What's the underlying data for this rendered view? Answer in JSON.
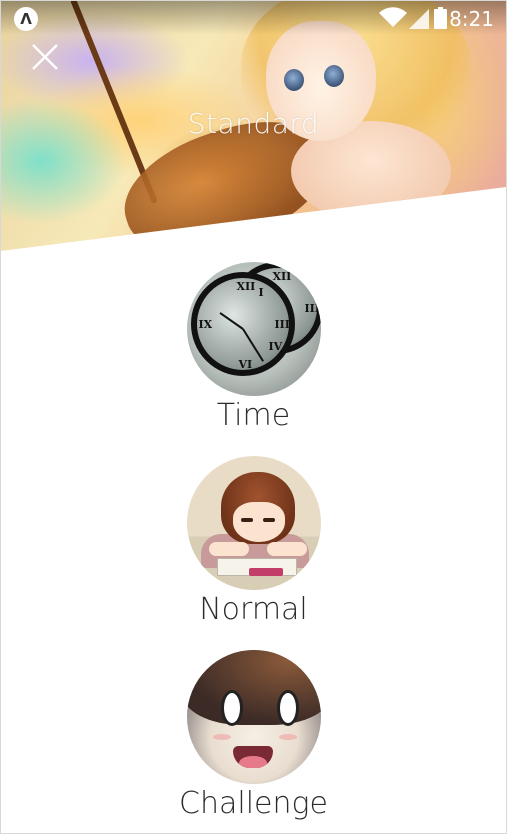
{
  "status_bar": {
    "app_badge": "Λ",
    "time": "8:21"
  },
  "header": {
    "title": "Standard"
  },
  "modes": [
    {
      "label": "Time",
      "thumb_icon": "clock-thumbnail"
    },
    {
      "label": "Normal",
      "thumb_icon": "studying-girl-thumbnail"
    },
    {
      "label": "Challenge",
      "thumb_icon": "surprised-face-thumbnail"
    }
  ],
  "colors": {
    "label_text": "#2b2b2b",
    "background": "#ffffff"
  }
}
